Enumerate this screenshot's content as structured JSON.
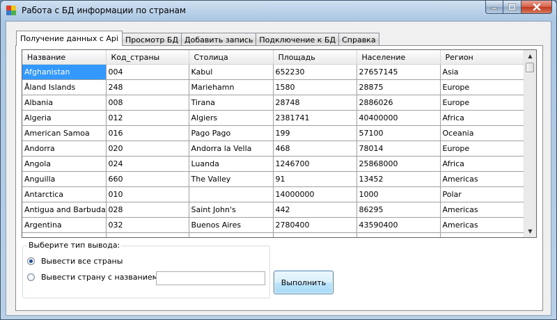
{
  "window": {
    "title": "Работа с БД информации по странам",
    "minimize_glyph": "▬",
    "maximize_glyph": "❐",
    "close_glyph": "✕"
  },
  "tabs": [
    {
      "label": "Получение данных с Api",
      "active": true
    },
    {
      "label": "Просмотр БД",
      "active": false
    },
    {
      "label": "Добавить запись",
      "active": false
    },
    {
      "label": "Подключение к БД",
      "active": false
    },
    {
      "label": "Справка",
      "active": false
    }
  ],
  "grid": {
    "columns": [
      "Название",
      "Код_страны",
      "Столица",
      "Площадь",
      "Население",
      "Регион"
    ],
    "rows": [
      [
        "Afghanistan",
        "004",
        "Kabul",
        "652230",
        "27657145",
        "Asia"
      ],
      [
        "Åland Islands",
        "248",
        "Mariehamn",
        "1580",
        "28875",
        "Europe"
      ],
      [
        "Albania",
        "008",
        "Tirana",
        "28748",
        "2886026",
        "Europe"
      ],
      [
        "Algeria",
        "012",
        "Algiers",
        "2381741",
        "40400000",
        "Africa"
      ],
      [
        "American Samoa",
        "016",
        "Pago Pago",
        "199",
        "57100",
        "Oceania"
      ],
      [
        "Andorra",
        "020",
        "Andorra la Vella",
        "468",
        "78014",
        "Europe"
      ],
      [
        "Angola",
        "024",
        "Luanda",
        "1246700",
        "25868000",
        "Africa"
      ],
      [
        "Anguilla",
        "660",
        "The Valley",
        "91",
        "13452",
        "Americas"
      ],
      [
        "Antarctica",
        "010",
        "",
        "14000000",
        "1000",
        "Polar"
      ],
      [
        "Antigua and Barbuda",
        "028",
        "Saint John's",
        "442",
        "86295",
        "Americas"
      ],
      [
        "Argentina",
        "032",
        "Buenos Aires",
        "2780400",
        "43590400",
        "Americas"
      ],
      [
        "",
        "",
        "",
        "",
        "",
        ""
      ]
    ],
    "selected_cell": "Afghanistan",
    "scroll_up": "▲",
    "scroll_down": "▼"
  },
  "output_group": {
    "legend": "Выберите тип вывода:",
    "option_all": "Вывести все страны",
    "option_by_name": "Вывести страну с названием:",
    "selected": "all",
    "name_value": ""
  },
  "run_button": "Выполнить",
  "colors": {
    "selection": "#3399ff",
    "close_button": "#c0391f",
    "title_bar": "#bcd3ea"
  }
}
